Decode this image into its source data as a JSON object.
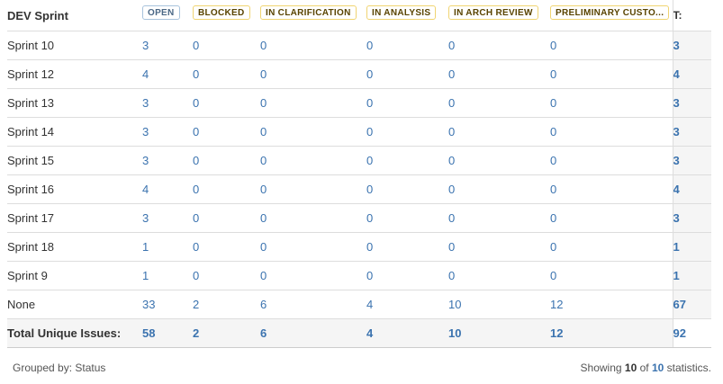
{
  "table": {
    "row_header": "DEV Sprint",
    "columns": [
      {
        "label": "OPEN",
        "style": "blue"
      },
      {
        "label": "BLOCKED",
        "style": "yellow"
      },
      {
        "label": "IN CLARIFICATION",
        "style": "yellow"
      },
      {
        "label": "IN ANALYSIS",
        "style": "yellow"
      },
      {
        "label": "IN ARCH REVIEW",
        "style": "yellow"
      },
      {
        "label": "PRELIMINARY CUSTO...",
        "style": "yellow"
      }
    ],
    "total_header": "T:",
    "rows": [
      {
        "label": "Sprint 10",
        "values": [
          "3",
          "0",
          "0",
          "0",
          "0",
          "0"
        ],
        "total": "3"
      },
      {
        "label": "Sprint 12",
        "values": [
          "4",
          "0",
          "0",
          "0",
          "0",
          "0"
        ],
        "total": "4"
      },
      {
        "label": "Sprint 13",
        "values": [
          "3",
          "0",
          "0",
          "0",
          "0",
          "0"
        ],
        "total": "3"
      },
      {
        "label": "Sprint 14",
        "values": [
          "3",
          "0",
          "0",
          "0",
          "0",
          "0"
        ],
        "total": "3"
      },
      {
        "label": "Sprint 15",
        "values": [
          "3",
          "0",
          "0",
          "0",
          "0",
          "0"
        ],
        "total": "3"
      },
      {
        "label": "Sprint 16",
        "values": [
          "4",
          "0",
          "0",
          "0",
          "0",
          "0"
        ],
        "total": "4"
      },
      {
        "label": "Sprint 17",
        "values": [
          "3",
          "0",
          "0",
          "0",
          "0",
          "0"
        ],
        "total": "3"
      },
      {
        "label": "Sprint 18",
        "values": [
          "1",
          "0",
          "0",
          "0",
          "0",
          "0"
        ],
        "total": "1"
      },
      {
        "label": "Sprint 9",
        "values": [
          "1",
          "0",
          "0",
          "0",
          "0",
          "0"
        ],
        "total": "1"
      },
      {
        "label": "None",
        "values": [
          "33",
          "2",
          "6",
          "4",
          "10",
          "12"
        ],
        "total": "67"
      }
    ],
    "totals_row": {
      "label": "Total Unique Issues:",
      "values": [
        "58",
        "2",
        "6",
        "4",
        "10",
        "12"
      ],
      "total": "92"
    }
  },
  "footer": {
    "grouped_by_label": "Grouped by:",
    "grouped_by_value": "Status",
    "showing_prefix": "Showing",
    "shown_count": "10",
    "of_word": "of",
    "total_count": "10",
    "suffix": "statistics."
  },
  "colors": {
    "link": "#3b73af",
    "border": "#dddddd",
    "total_bg": "#f5f5f5"
  }
}
